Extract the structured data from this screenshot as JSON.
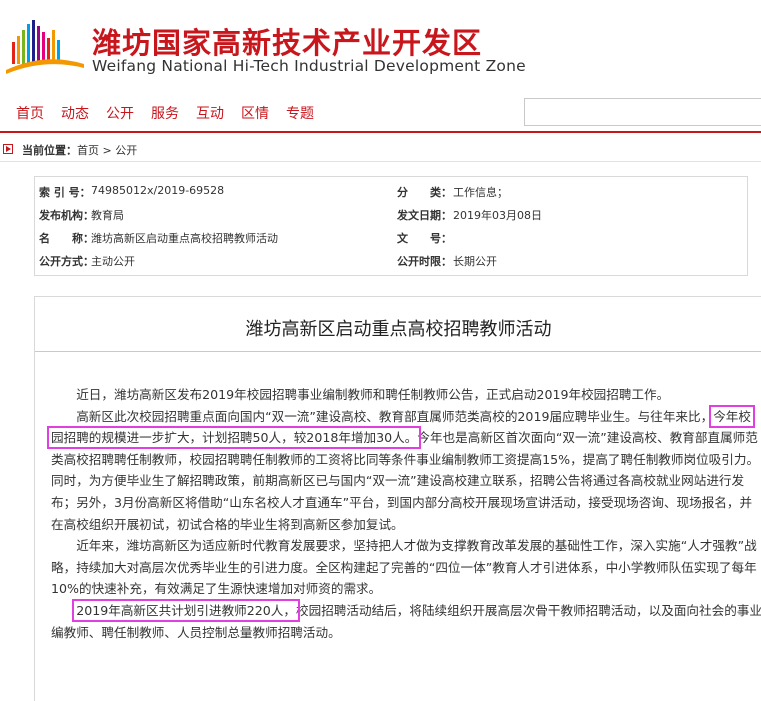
{
  "header": {
    "title": "潍坊国家高新技术产业开发区",
    "subtitle": "Weifang National Hi-Tech Industrial Development Zone"
  },
  "nav": {
    "items": [
      "首页",
      "动态",
      "公开",
      "服务",
      "互动",
      "区情",
      "专题"
    ],
    "search_placeholder": ""
  },
  "breadcrumb": {
    "label": "当前位置：",
    "home": "首页",
    "sep": " > ",
    "current": "公开"
  },
  "info": {
    "index_key": "索 引 号：",
    "index_val": "74985012x/2019-69528",
    "category_key": "分　　类：",
    "category_val": "工作信息；",
    "issuer_key": "发布机构：",
    "issuer_val": "教育局",
    "date_key": "发文日期：",
    "date_val": "2019年03月08日",
    "name_key": "名　　称：",
    "name_val": "潍坊高新区启动重点高校招聘教师活动",
    "docno_key": "文　　号：",
    "docno_val": "",
    "mode_key": "公开方式：",
    "mode_val": "主动公开",
    "period_key": "公开时限：",
    "period_val": "长期公开"
  },
  "article": {
    "title": "潍坊高新区启动重点高校招聘教师活动",
    "p1": "近日，潍坊高新区发布2019年校园招聘事业编制教师和聘任制教师公告，正式启动2019年校园招聘工作。",
    "p2_a": "高新区此次校园招聘重点面向国内“双一流”建设高校、教育部直属师范类高校的2019届应聘毕业生。与往年来比，",
    "p2_hl": "今年校园招聘的规模进一步扩大，计划招聘50人，较2018年增加30人。",
    "p2_b": "今年也是高新区首次面向“双一流”建设高校、教育部直属师范类高校招聘聘任制教师，校园招聘聘任制教师的工资将比同等条件事业编制教师工资提高15%，提高了聘任制教师岗位吸引力。同时，为方便毕业生了解招聘政策，前期高新区已与国内“双一流”建设高校建立联系，招聘公告将通过各高校就业网站进行发布；另外，3月份高新区将借助“山东名校人才直通车”平台，到国内部分高校开展现场宣讲活动，接受现场咨询、现场报名，并在高校组织开展初试，初试合格的毕业生将到高新区参加复试。",
    "p3": "近年来，潍坊高新区为适应新时代教育发展要求，坚持把人才做为支撑教育改革发展的基础性工作，深入实施“人才强教”战略，持续加大对高层次优秀毕业生的引进力度。全区构建起了完善的“四位一体”教育人才引进体系，中小学教师队伍实现了每年10%的快速补充，有效满足了生源快速增加对师资的需求。",
    "p4_hl": "2019年高新区共计划引进教师220人，",
    "p4_b": "校园招聘活动结后，将陆续组织开展高层次骨干教师招聘活动，以及面向社会的事业编教师、聘任制教师、人员控制总量教师招聘活动。"
  },
  "colors": {
    "brand_red": "#c8161d",
    "highlight_box": "#e040e0"
  }
}
